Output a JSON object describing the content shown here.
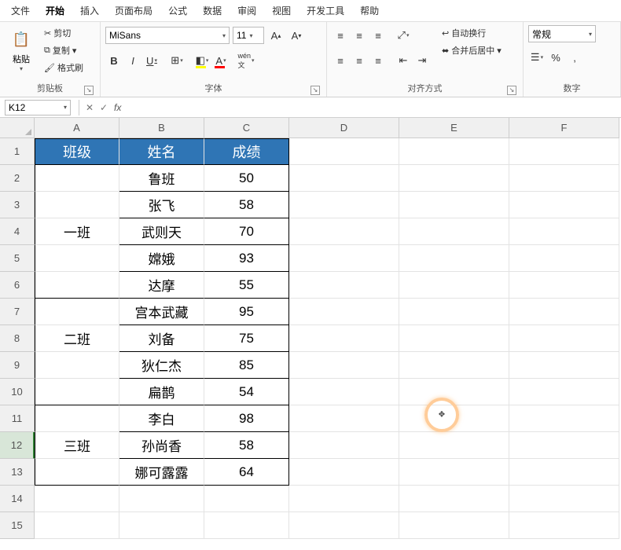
{
  "menu": {
    "items": [
      "文件",
      "开始",
      "插入",
      "页面布局",
      "公式",
      "数据",
      "审阅",
      "视图",
      "开发工具",
      "帮助"
    ],
    "active_index": 1
  },
  "ribbon": {
    "clipboard": {
      "paste": "粘贴",
      "cut": "剪切",
      "copy": "复制",
      "format_painter": "格式刷",
      "label": "剪贴板"
    },
    "font": {
      "name": "MiSans",
      "size": "11",
      "label": "字体"
    },
    "align": {
      "wrap": "自动换行",
      "merge": "合并后居中",
      "label": "对齐方式"
    },
    "number": {
      "format": "常规",
      "label": "数字"
    }
  },
  "namebox": "K12",
  "formula": "",
  "columns": [
    "A",
    "B",
    "C",
    "D",
    "E",
    "F"
  ],
  "row_count": 15,
  "selected_row": 12,
  "table": {
    "header": [
      "班级",
      "姓名",
      "成绩"
    ],
    "groups": [
      {
        "class": "一班",
        "rows": [
          [
            "鲁班",
            "50"
          ],
          [
            "张飞",
            "58"
          ],
          [
            "武则天",
            "70"
          ],
          [
            "嫦娥",
            "93"
          ],
          [
            "达摩",
            "55"
          ]
        ]
      },
      {
        "class": "二班",
        "rows": [
          [
            "宫本武藏",
            "95"
          ],
          [
            "刘备",
            "75"
          ],
          [
            "狄仁杰",
            "85"
          ],
          [
            "扁鹊",
            "54"
          ]
        ]
      },
      {
        "class": "三班",
        "rows": [
          [
            "李白",
            "98"
          ],
          [
            "孙尚香",
            "58"
          ],
          [
            "娜可露露",
            "64"
          ]
        ]
      }
    ]
  }
}
